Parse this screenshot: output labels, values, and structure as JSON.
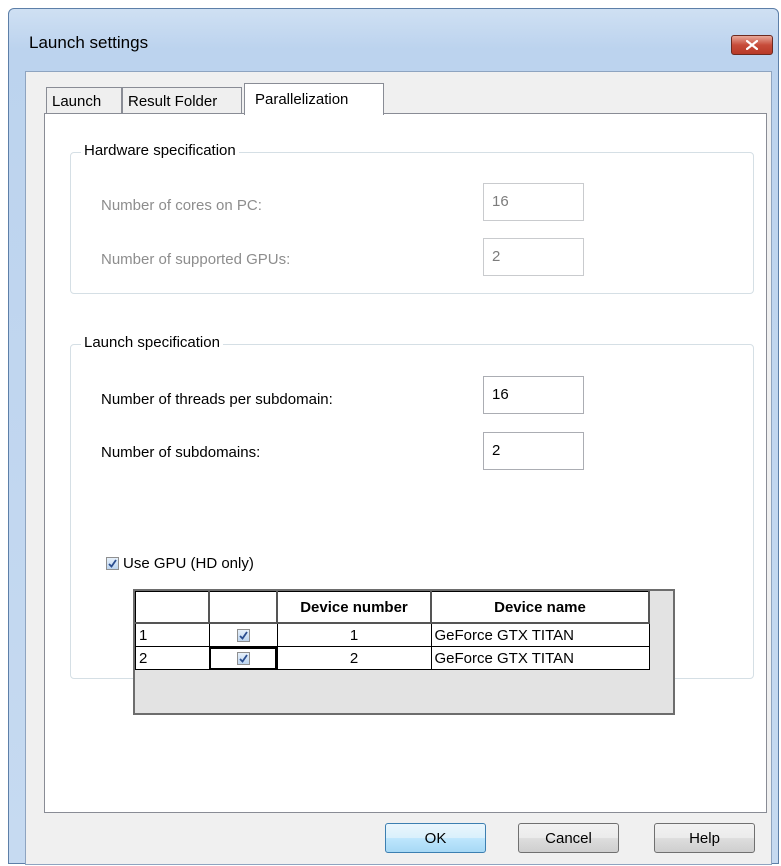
{
  "window": {
    "title": "Launch settings"
  },
  "tabs": [
    {
      "label": "Launch"
    },
    {
      "label": "Result Folder"
    },
    {
      "label": "Parallelization"
    }
  ],
  "hardware": {
    "title": "Hardware specification",
    "cores_label": "Number of cores on PC:",
    "cores_value": "16",
    "gpus_label": "Number of supported GPUs:",
    "gpus_value": "2"
  },
  "launch_spec": {
    "title": "Launch specification",
    "threads_label": "Number of threads per subdomain:",
    "threads_value": "16",
    "subdomains_label": "Number of subdomains:",
    "subdomains_value": "2",
    "use_gpu_label": "Use GPU (HD only)",
    "use_gpu_checked": true
  },
  "gpu_table": {
    "headers": [
      "",
      "",
      "Device number",
      "Device name"
    ],
    "rows": [
      {
        "index": "1",
        "checked": true,
        "device_number": "1",
        "device_name": "GeForce GTX TITAN"
      },
      {
        "index": "2",
        "checked": true,
        "device_number": "2",
        "device_name": "GeForce GTX TITAN"
      }
    ]
  },
  "buttons": {
    "ok": "OK",
    "cancel": "Cancel",
    "help": "Help"
  },
  "colors": {
    "title_bar": "#bcd3ee",
    "close_button": "#c74c3a",
    "default_button": "#bee6fd"
  }
}
